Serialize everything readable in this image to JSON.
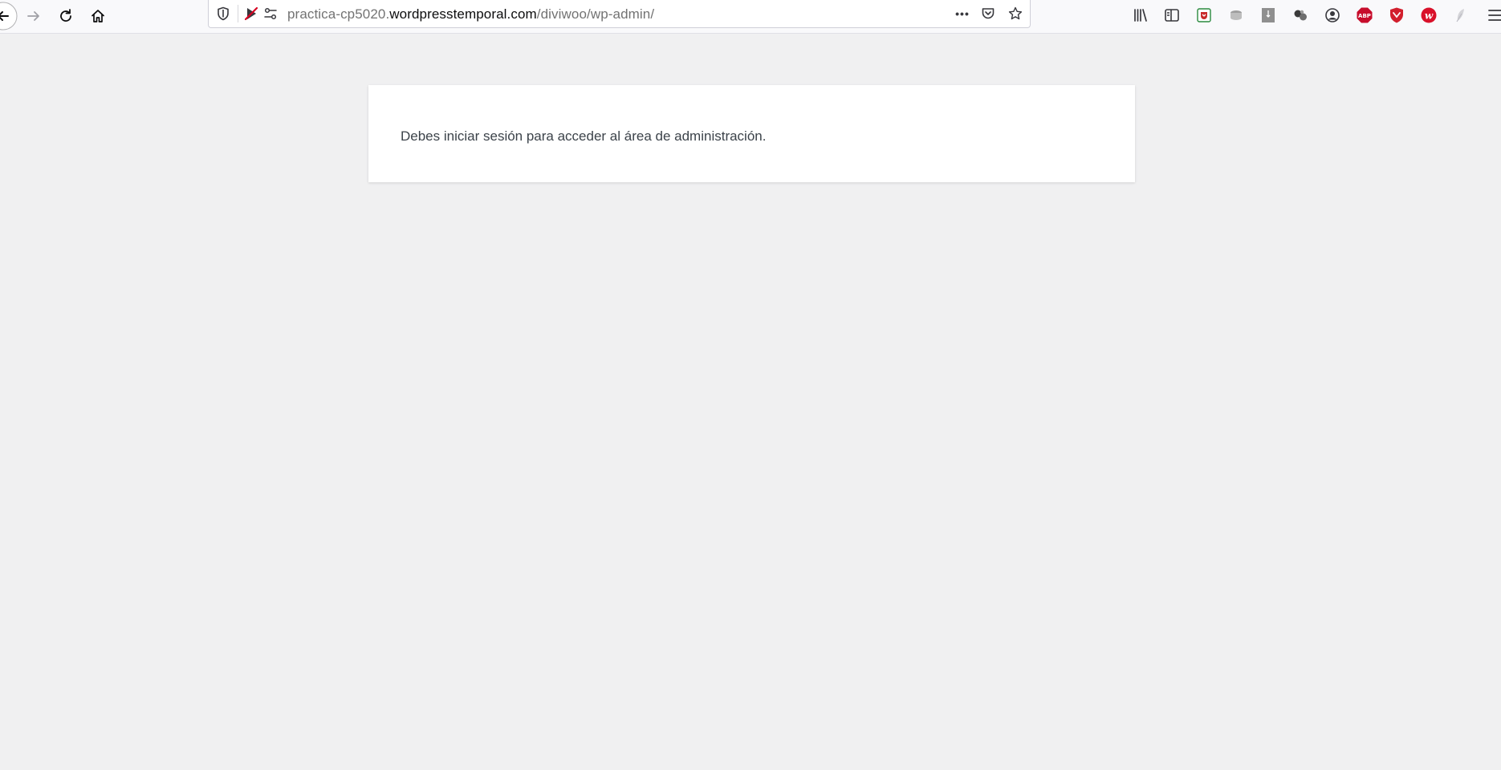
{
  "browser": {
    "url_prefix": "practica-cp5020.",
    "url_domain": "wordpresstemporal.com",
    "url_path": "/diviwoo/wp-admin/",
    "more_label": "•••",
    "ext_abp_label": "ABP",
    "ext_w_label": "w"
  },
  "page": {
    "message": "Debes iniciar sesión para acceder al área de administración."
  },
  "colors": {
    "background": "#f0f0f1",
    "box": "#ffffff",
    "text": "#3c434a",
    "abp_red": "#c70d2c"
  }
}
